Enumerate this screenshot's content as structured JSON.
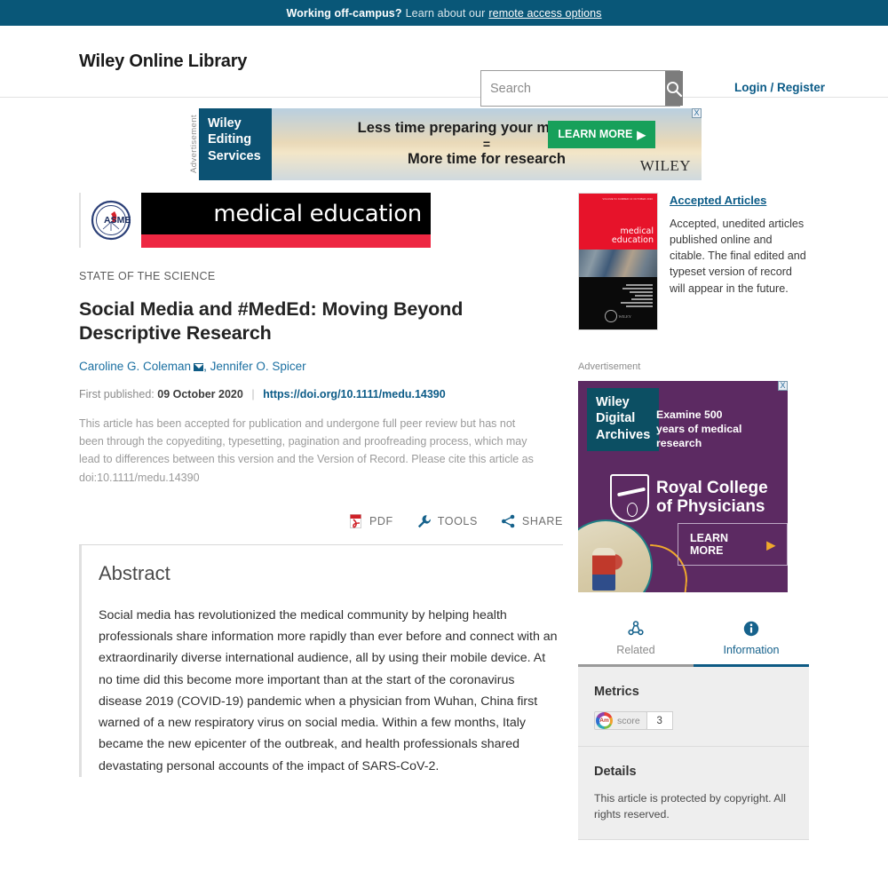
{
  "offcampus": {
    "lead": "Working off-campus?",
    "text": "Learn about our",
    "link": "remote access options"
  },
  "header": {
    "brand": "Wiley Online Library",
    "search_placeholder": "Search",
    "search_value": "",
    "search_icon": "search-icon",
    "login": "Login / Register"
  },
  "ad_leaderboard": {
    "label": "Advertisement",
    "block": "Wiley\nEditing\nServices",
    "block_l1": "Wiley",
    "block_l2": "Editing",
    "block_l3": "Services",
    "line1": "Less time preparing your manuscript",
    "equals": "=",
    "line2": "More time for research",
    "cta": "LEARN MORE",
    "cta_arrow": "▶",
    "wiley": "WILEY",
    "close": "X"
  },
  "masthead": {
    "society_logo": "ASME",
    "journal": "medical education"
  },
  "article": {
    "kicker": "STATE OF THE SCIENCE",
    "title": "Social Media and #MedEd: Moving Beyond Descriptive Research",
    "authors": [
      {
        "name": "Caroline G. Coleman",
        "corresponding": true
      },
      {
        "name": "Jennifer O. Spicer",
        "corresponding": false
      }
    ],
    "author_separator": ",",
    "first_published_label": "First published:",
    "first_published_date": "09 October 2020",
    "separator": "|",
    "doi": "https://doi.org/10.1111/medu.14390",
    "disclaimer": "This article has been accepted for publication and undergone full peer review but has not been through the copyediting, typesetting, pagination and proofreading process, which may lead to differences between this version and the Version of Record. Please cite this article as doi:10.1111/medu.14390"
  },
  "toolbar": {
    "pdf": "PDF",
    "tools": "TOOLS",
    "share": "SHARE"
  },
  "abstract": {
    "heading": "Abstract",
    "body": "Social media has revolutionized the medical community by helping health professionals share information more rapidly than ever before and connect with an extraordinarily diverse international audience, all by using their mobile device. At no time did this become more important than at the start of the coronavirus disease 2019 (COVID-19) pandemic when a physician from Wuhan, China first warned of a new respiratory virus on social media. Within a few months, Italy became the new epicenter of the outbreak, and health professionals shared devastating personal accounts of the impact of SARS-CoV-2."
  },
  "sidebar": {
    "accepted": {
      "link": "Accepted Articles",
      "description": "Accepted, unedited articles published online and citable. The final edited and typeset version of record will appear in the future.",
      "cover_title_l1": "medical",
      "cover_title_l2": "education",
      "cover_wiley": "WILEY"
    },
    "ad": {
      "label": "Advertisement",
      "brand_l1": "Wiley",
      "brand_l2": "Digital",
      "brand_l3": "Archives",
      "tagline_l1": "Examine 500",
      "tagline_l2": "years of medical",
      "tagline_l3": "research",
      "org_l1": "Royal College",
      "org_l2": "of Physicians",
      "cta": "LEARN MORE",
      "cta_arrow": "▶",
      "close": "X"
    },
    "tabs": [
      {
        "label": "Related",
        "icon": "related-nodes-icon",
        "active": false
      },
      {
        "label": "Information",
        "icon": "info-circle-icon",
        "active": true
      }
    ],
    "metrics": {
      "heading": "Metrics",
      "altmetric_badge": "Am",
      "altmetric_label": "score",
      "altmetric_score": "3"
    },
    "details": {
      "heading": "Details",
      "text": "This article is protected by copyright. All rights reserved."
    }
  },
  "colors": {
    "banner": "#095778",
    "link": "#0b5b87",
    "journal_red": "#ee2742",
    "ad_purple": "#5c2a62",
    "ad_green": "#17a05a"
  }
}
